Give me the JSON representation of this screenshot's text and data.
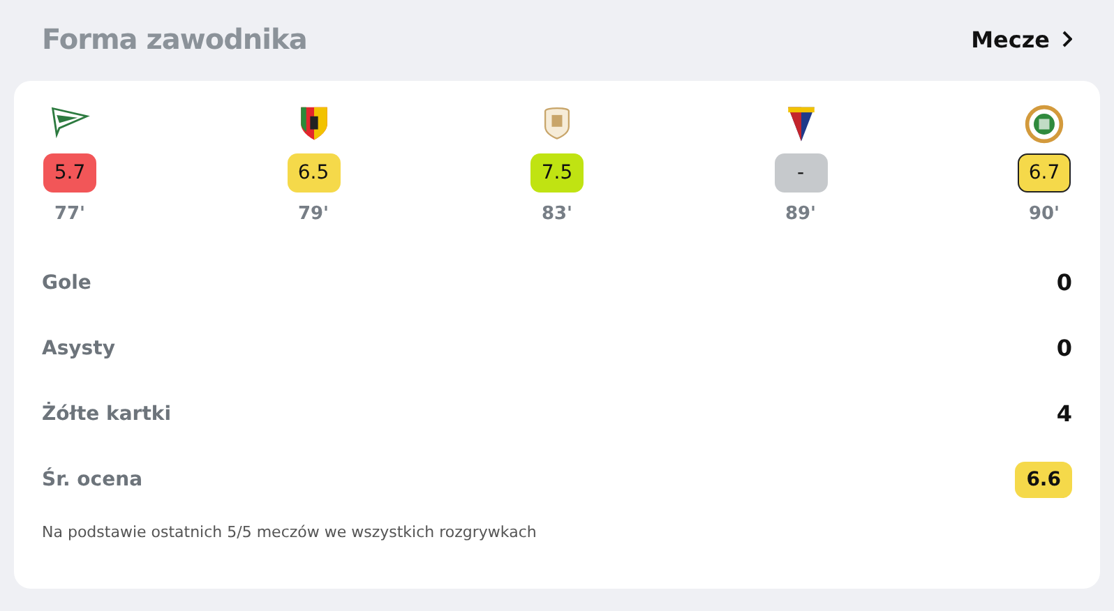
{
  "header": {
    "title": "Forma zawodnika",
    "link": "Mecze"
  },
  "matches": [
    {
      "kind": "pennant",
      "rating": "5.7",
      "color": "#f25658",
      "minute": "77'",
      "highlighted": false
    },
    {
      "kind": "shield",
      "rating": "6.5",
      "color": "#f5d94a",
      "minute": "79'",
      "highlighted": false
    },
    {
      "kind": "crest",
      "rating": "7.5",
      "color": "#c0e312",
      "minute": "83'",
      "highlighted": false
    },
    {
      "kind": "triangle",
      "rating": "-",
      "color": "#c6c9cc",
      "minute": "89'",
      "highlighted": false
    },
    {
      "kind": "round",
      "rating": "6.7",
      "color": "#f5d94a",
      "minute": "90'",
      "highlighted": true
    }
  ],
  "stats": [
    {
      "label": "Gole",
      "value": "0",
      "kind": "number"
    },
    {
      "label": "Asysty",
      "value": "0",
      "kind": "number"
    },
    {
      "label": "Żółte kartki",
      "value": "4",
      "kind": "number"
    },
    {
      "label": "Śr. ocena",
      "value": "6.6",
      "kind": "rating",
      "color": "#f5d94a"
    }
  ],
  "footnote": "Na podstawie ostatnich 5/5 meczów we wszystkich rozgrywkach"
}
